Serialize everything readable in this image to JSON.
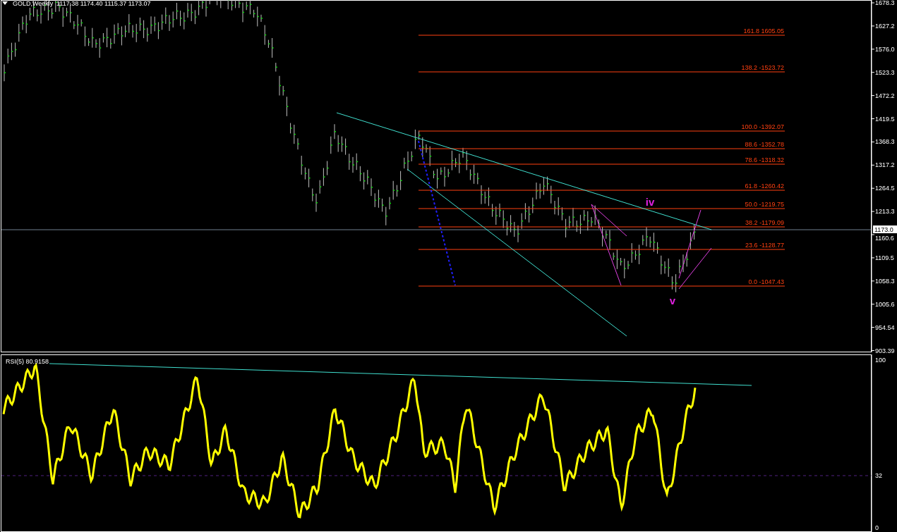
{
  "price_panel": {
    "title": "GOLD,Weekly",
    "ohlc": "1117.38 1174.40 1115.37 1173.07",
    "fib_levels": [
      {
        "label": "161.8 1605.05"
      },
      {
        "label": "138.2  -1523.72"
      },
      {
        "label": "100.0 -1392.07"
      },
      {
        "label": "88.6 -1352.78"
      },
      {
        "label": "78.6 -1318.32"
      },
      {
        "label": "61.8 -1260.42"
      },
      {
        "label": "50.0 -1219.75"
      },
      {
        "label": "38.2 -1179.09"
      },
      {
        "label": "23.6 -1128.77"
      },
      {
        "label": "0.0 -1047.43"
      }
    ],
    "wave_labels": [
      {
        "label": "iv"
      },
      {
        "label": "v"
      }
    ],
    "price_axis": [
      "1678.3",
      "1627.2",
      "1576.0",
      "1523.3",
      "1472.2",
      "1419.5",
      "1368.3",
      "1317.2",
      "1264.5",
      "1213.3",
      "1160.6",
      "1109.5",
      "1058.3",
      "1005.6",
      "954.54",
      "903.39"
    ],
    "current_price": "1173.0"
  },
  "rsi_panel": {
    "title": "RSI(5) 80.9158",
    "axis": [
      "100",
      "32",
      "0"
    ]
  }
}
